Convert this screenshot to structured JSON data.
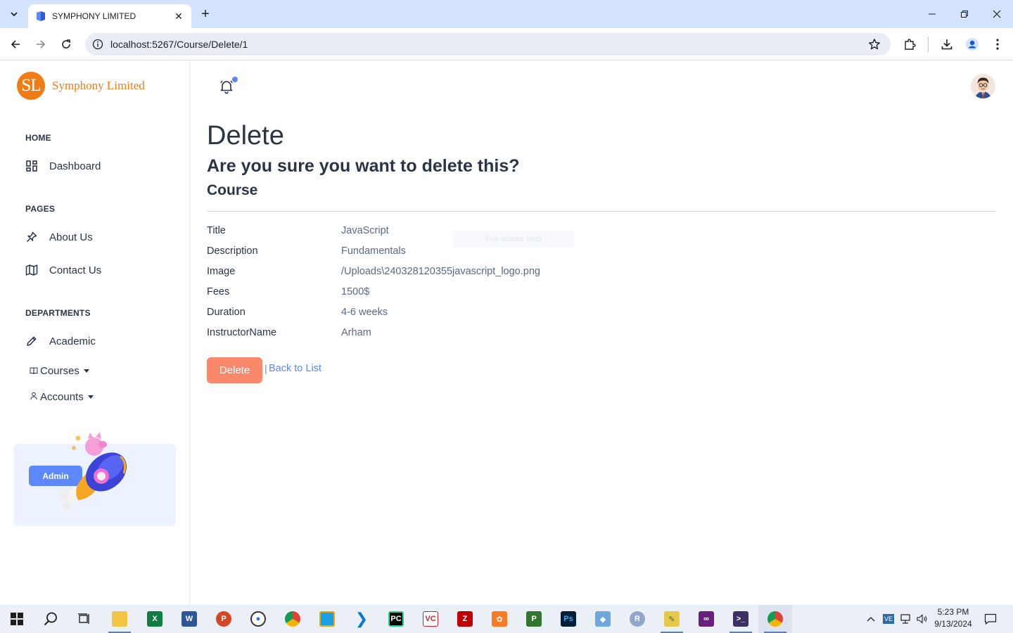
{
  "browser": {
    "tab_title": "SYMPHONY LIMITED",
    "url": "localhost:5267/Course/Delete/1"
  },
  "sidebar": {
    "logo_initials": "SL",
    "logo_text": "Symphony Limited",
    "sections": [
      {
        "caption": "HOME",
        "items": [
          {
            "label": "Dashboard",
            "icon": "dashboard-icon"
          }
        ]
      },
      {
        "caption": "PAGES",
        "items": [
          {
            "label": "About Us",
            "icon": "pin-icon"
          },
          {
            "label": "Contact Us",
            "icon": "map-icon"
          }
        ]
      },
      {
        "caption": "DEPARTMENTS",
        "items": [
          {
            "label": "Academic",
            "icon": "pencil-icon"
          }
        ]
      }
    ],
    "dropdowns": [
      {
        "label": "Courses",
        "icon": "book-icon"
      },
      {
        "label": "Accounts",
        "icon": "person-icon"
      }
    ],
    "promo_button": "Admin"
  },
  "main": {
    "title": "Delete",
    "question": "Are you sure you want to delete this?",
    "entity": "Course",
    "fields": [
      {
        "label": "Title",
        "value": "JavaScript"
      },
      {
        "label": "Description",
        "value": "Fundamentals"
      },
      {
        "label": "Image",
        "value": "/Uploads\\240328120355javascript_logo.png"
      },
      {
        "label": "Fees",
        "value": "1500$"
      },
      {
        "label": "Duration",
        "value": "4-6 weeks"
      },
      {
        "label": "InstructorName",
        "value": "Arham"
      }
    ],
    "watermark": "Full-screen Snip",
    "delete_button": "Delete",
    "separator": "|",
    "back_link": "Back to List"
  },
  "taskbar": {
    "time": "5:23 PM",
    "date": "9/13/2024",
    "apps": [
      "start",
      "search",
      "task-view",
      "file-explorer",
      "excel",
      "word",
      "powerpoint",
      "app",
      "chrome",
      "app",
      "vscode",
      "pycharm",
      "vc",
      "filezilla",
      "xampp",
      "project",
      "photoshop",
      "virtualbox",
      "r",
      "app",
      "visual-studio",
      "terminal",
      "chrome-profile"
    ]
  },
  "colors": {
    "accent": "#5d87ff",
    "danger": "#fa896b",
    "logo": "#f07c16",
    "chrome_tabbar": "#d3e3fd"
  }
}
